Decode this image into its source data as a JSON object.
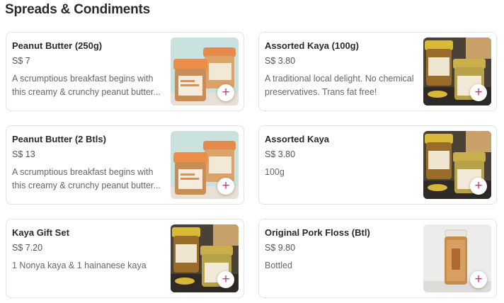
{
  "section": {
    "title": "Spreads & Condiments"
  },
  "products": [
    {
      "name": "Peanut Butter (250g)",
      "price": "S$ 7",
      "description": "A scrumptious breakfast begins with this creamy & crunchy peanut butter...",
      "image": "peanut-butter-jars"
    },
    {
      "name": "Assorted Kaya (100g)",
      "price": "S$ 3.80",
      "description": "A traditional local delight. No chemical preservatives. Trans fat free!",
      "image": "kaya-jars"
    },
    {
      "name": "Peanut Butter (2 Btls)",
      "price": "S$ 13",
      "description": "A scrumptious breakfast begins with this creamy & crunchy peanut butter...",
      "image": "peanut-butter-jars"
    },
    {
      "name": "Assorted Kaya",
      "price": "S$ 3.80",
      "description": "100g",
      "image": "kaya-jars"
    },
    {
      "name": "Kaya Gift Set",
      "price": "S$ 7.20",
      "description": "1 Nonya kaya & 1 hainanese kaya",
      "image": "kaya-jars"
    },
    {
      "name": "Original Pork Floss (Btl)",
      "price": "S$ 9.80",
      "description": "Bottled",
      "image": "pork-floss-bottle"
    }
  ],
  "add_icon": "+",
  "colors": {
    "accent": "#d7336a",
    "border": "#e3e3e3"
  }
}
